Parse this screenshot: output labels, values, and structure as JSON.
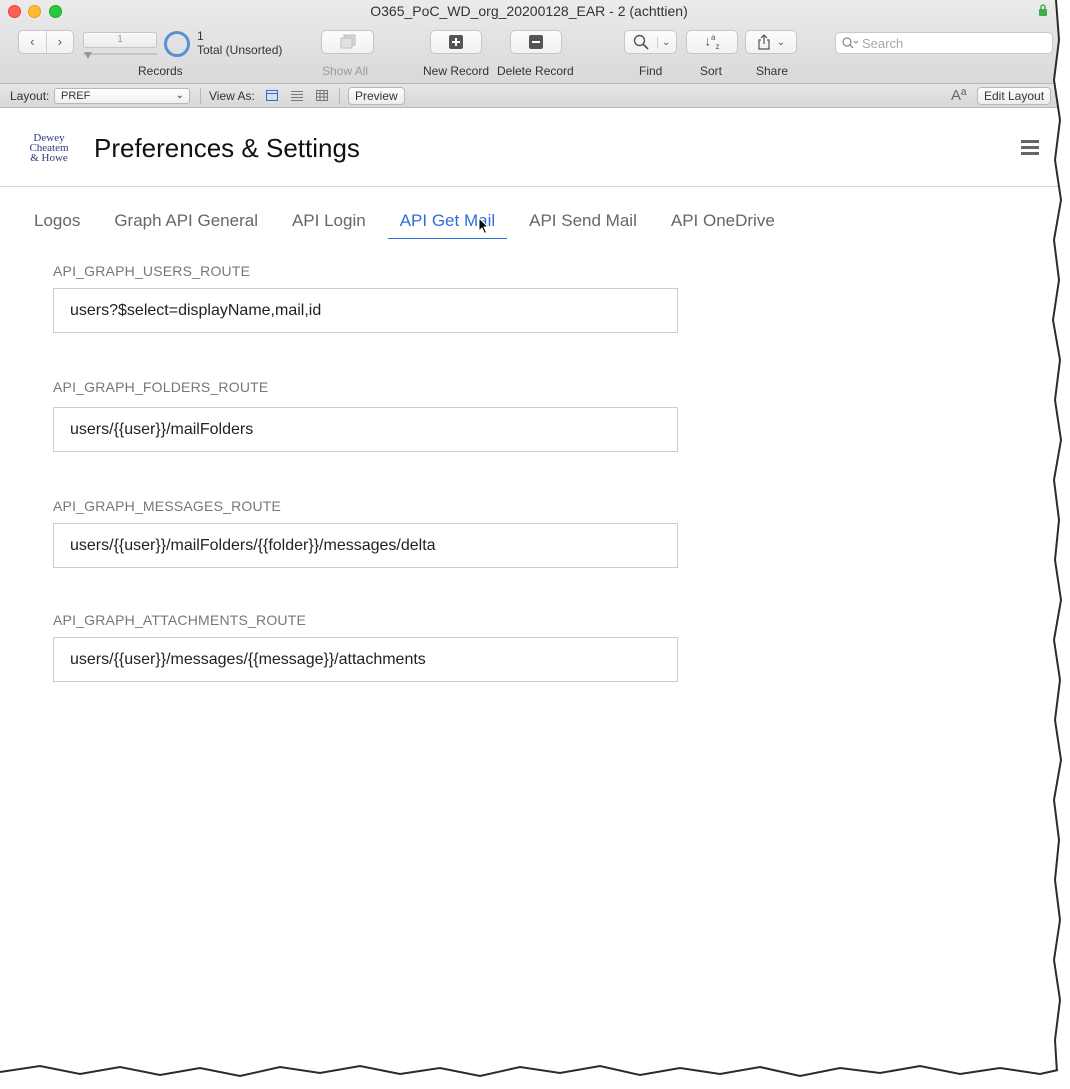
{
  "window": {
    "title": "O365_PoC_WD_org_20200128_EAR - 2 (achttien)"
  },
  "toolbar": {
    "record_number": "1",
    "found_count": "1",
    "total_label": "Total (Unsorted)",
    "records_label": "Records",
    "show_all_label": "Show All",
    "new_record_label": "New Record",
    "delete_record_label": "Delete Record",
    "find_label": "Find",
    "sort_label": "Sort",
    "share_label": "Share",
    "search_placeholder": "Search"
  },
  "layout_bar": {
    "layout_label": "Layout:",
    "layout_value": "PREF",
    "view_as_label": "View As:",
    "preview_label": "Preview",
    "font_glyph": "Aª",
    "edit_layout_label": "Edit Layout"
  },
  "header": {
    "logo_text": [
      "Dewey",
      "Cheatem",
      "& Howe"
    ],
    "title": "Preferences & Settings"
  },
  "tabs": [
    {
      "label": "Logos",
      "active": false
    },
    {
      "label": "Graph API General",
      "active": false
    },
    {
      "label": "API Login",
      "active": false
    },
    {
      "label": "API Get Mail",
      "active": true
    },
    {
      "label": "API Send Mail",
      "active": false
    },
    {
      "label": "API OneDrive",
      "active": false
    }
  ],
  "fields": [
    {
      "label": "API_GRAPH_USERS_ROUTE",
      "value": "users?$select=displayName,mail,id"
    },
    {
      "label": "API_GRAPH_FOLDERS_ROUTE",
      "value": "users/{{user}}/mailFolders"
    },
    {
      "label": "API_GRAPH_MESSAGES_ROUTE",
      "value": "users/{{user}}/mailFolders/{{folder}}/messages/delta"
    },
    {
      "label": "API_GRAPH_ATTACHMENTS_ROUTE",
      "value": "users/{{user}}/messages/{{message}}/attachments"
    }
  ],
  "colors": {
    "accent": "#2c6fd6",
    "close": "#ff5f57",
    "minimize": "#febc2e",
    "zoom": "#28c840"
  }
}
